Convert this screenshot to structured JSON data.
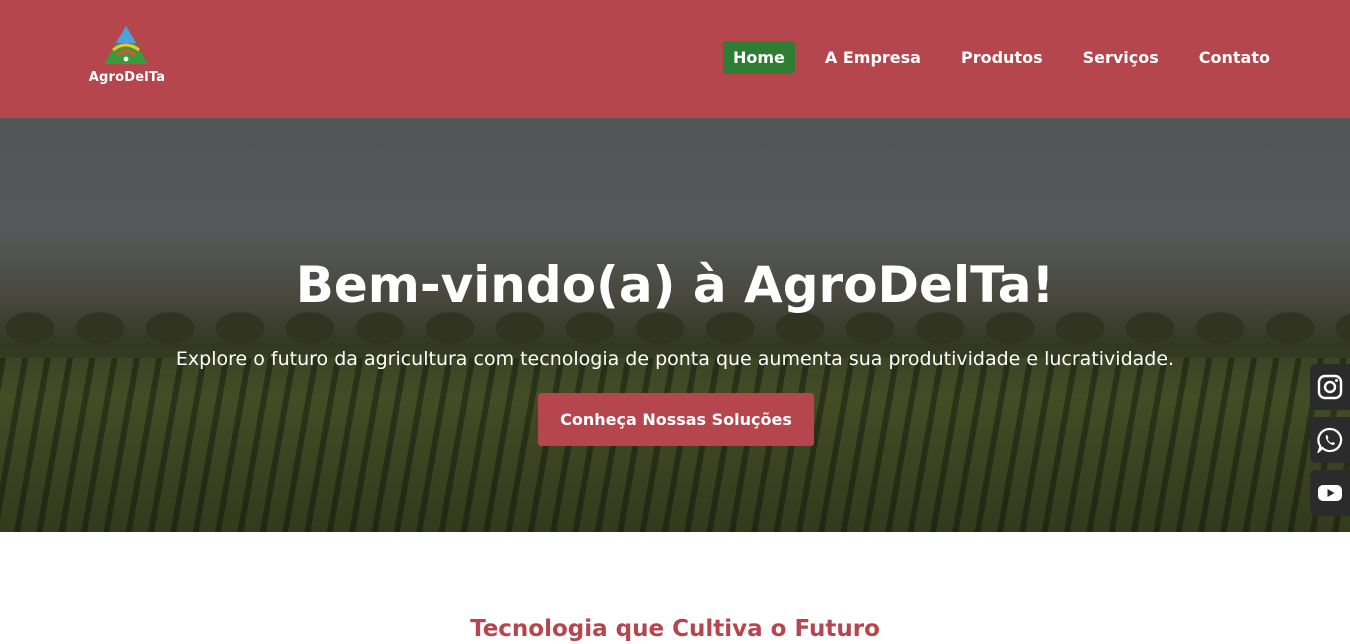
{
  "brand": {
    "name": "AgroDelTa",
    "accent_color": "#b5464d",
    "active_color": "#2f7d32"
  },
  "nav": {
    "items": [
      {
        "label": "Home",
        "active": true
      },
      {
        "label": "A Empresa",
        "active": false
      },
      {
        "label": "Produtos",
        "active": false
      },
      {
        "label": "Serviços",
        "active": false
      },
      {
        "label": "Contato",
        "active": false
      }
    ]
  },
  "hero": {
    "title": "Bem-vindo(a) à AgroDelTa!",
    "subtitle": "Explore o futuro da agricultura com tecnologia de ponta que aumenta sua produtividade e lucratividade.",
    "cta_label": "Conheça Nossas Soluções"
  },
  "social": {
    "icons": [
      "instagram-icon",
      "whatsapp-icon",
      "youtube-icon"
    ]
  },
  "section": {
    "title": "Tecnologia que Cultiva o Futuro"
  }
}
